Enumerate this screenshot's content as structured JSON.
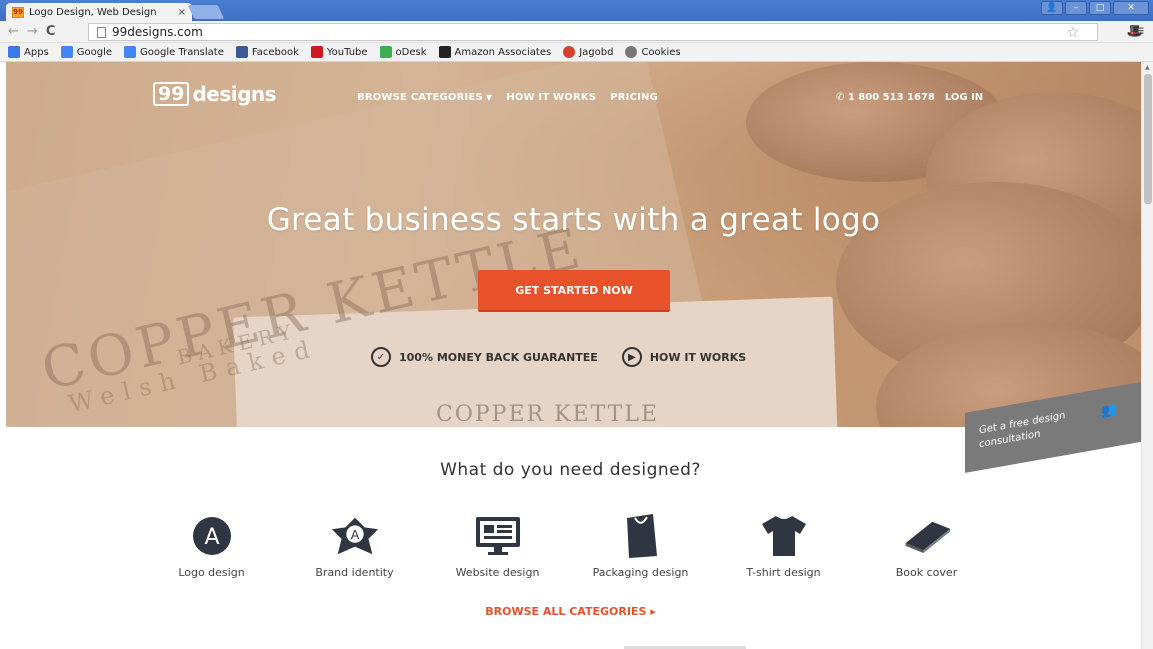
{
  "browser": {
    "tab_title": "Logo Design, Web Design",
    "tab_close": "×",
    "url": "99designs.com",
    "win_min": "–",
    "win_max": "□",
    "win_close": "✕",
    "bookmarks": [
      {
        "label": "Apps",
        "color": "#3b78e7"
      },
      {
        "label": "Google",
        "color": "#4285f4"
      },
      {
        "label": "Google Translate",
        "color": "#4285f4"
      },
      {
        "label": "Facebook",
        "color": "#3b5998"
      },
      {
        "label": "YouTube",
        "color": "#cc181e"
      },
      {
        "label": "oDesk",
        "color": "#3aaf4f"
      },
      {
        "label": "Amazon Associates",
        "color": "#222222"
      },
      {
        "label": "Jagobd",
        "color": "#d6402c"
      },
      {
        "label": "Cookies",
        "color": "#777777"
      }
    ]
  },
  "site": {
    "logo_num": "99",
    "logo_word": "designs",
    "nav": {
      "browse": "BROWSE CATEGORIES",
      "how": "HOW IT WORKS",
      "pricing": "PRICING"
    },
    "phone": "1 800 513 1678",
    "login": "LOG IN",
    "hero": {
      "headline": "Great business starts with a great logo",
      "cta": "GET STARTED NOW",
      "guarantee": "100% MONEY BACK GUARANTEE",
      "how": "HOW IT WORKS"
    },
    "consult": {
      "line1": "Get a free design",
      "line2": "consultation"
    },
    "need_title": "What do you need designed?",
    "categories": [
      {
        "label": "Logo design",
        "icon": "logo-design-icon"
      },
      {
        "label": "Brand identity",
        "icon": "brand-identity-icon"
      },
      {
        "label": "Website design",
        "icon": "website-design-icon"
      },
      {
        "label": "Packaging design",
        "icon": "packaging-design-icon"
      },
      {
        "label": "T-shirt design",
        "icon": "tshirt-design-icon"
      },
      {
        "label": "Book cover",
        "icon": "book-cover-icon"
      }
    ],
    "browse_all": "BROWSE ALL CATEGORIES ▸",
    "accent": "#e8522b"
  }
}
